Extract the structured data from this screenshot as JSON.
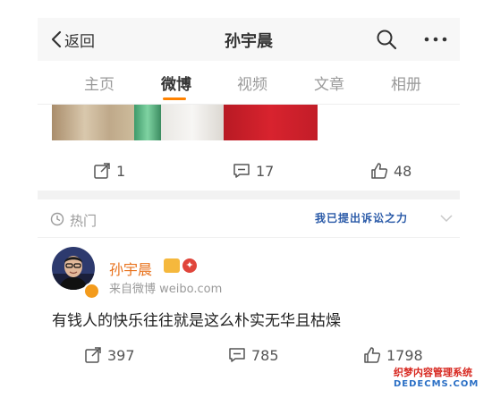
{
  "nav": {
    "back_label": "返回",
    "title": "孙宇晨"
  },
  "tabs": [
    {
      "label": "主页"
    },
    {
      "label": "微博"
    },
    {
      "label": "视频"
    },
    {
      "label": "文章"
    },
    {
      "label": "相册"
    }
  ],
  "active_tab": "微博",
  "post1": {
    "reposts": "1",
    "comments": "17",
    "likes": "48"
  },
  "hot": {
    "label": "热门",
    "sticker_text": "我已提出诉讼之力"
  },
  "post2": {
    "author": "孙宇晨",
    "source": "来自微博 weibo.com",
    "text": "有钱人的快乐往往就是这么朴实无华且枯燥",
    "reposts": "397",
    "comments": "785",
    "likes": "1798"
  },
  "watermark": {
    "line1": "织梦内容管理系统",
    "line2": "DEDECMS.COM"
  },
  "colors": {
    "accent": "#ff8200",
    "author_name": "#e8721d",
    "nav_bg": "#f7f7f7"
  }
}
